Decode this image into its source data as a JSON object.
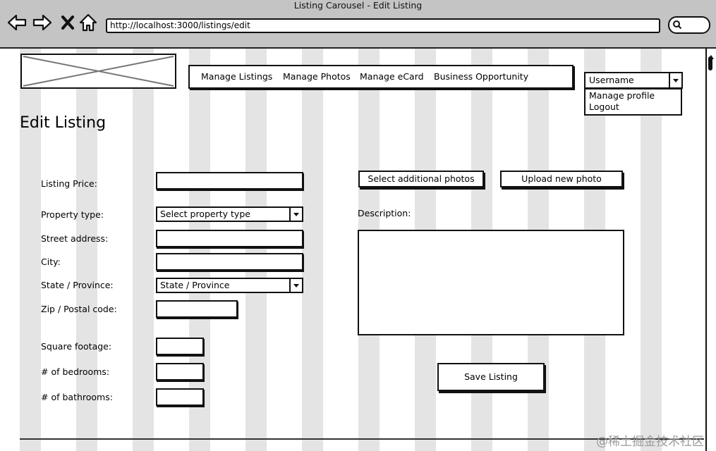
{
  "browser": {
    "window_title": "Listing Carousel - Edit Listing",
    "url": "http://localhost:3000/listings/edit",
    "nav_icons": [
      "back-arrow-icon",
      "forward-arrow-icon",
      "stop-icon",
      "home-icon"
    ],
    "search_icon": "search-icon"
  },
  "header": {
    "logo_icon": "image-placeholder-icon",
    "nav": [
      "Manage Listings",
      "Manage Photos",
      "Manage eCard",
      "Business Opportunity"
    ],
    "user": {
      "selected": "Username",
      "menu": [
        "Manage profile",
        "Logout"
      ]
    }
  },
  "main": {
    "title": "Edit Listing",
    "form": {
      "listing_price": {
        "label": "Listing Price:",
        "value": ""
      },
      "property_type": {
        "label": "Property type:",
        "value": "Select property type"
      },
      "street_address": {
        "label": "Street address:",
        "value": ""
      },
      "city": {
        "label": "City:",
        "value": ""
      },
      "state": {
        "label": "State / Province:",
        "value": "State / Province"
      },
      "zip": {
        "label": "Zip / Postal code:",
        "value": ""
      },
      "square_footage": {
        "label": "Square footage:",
        "value": ""
      },
      "bedrooms": {
        "label": "# of bedrooms:",
        "value": ""
      },
      "bathrooms": {
        "label": "# of bathrooms:",
        "value": ""
      }
    },
    "photos": {
      "select_label": "Select additional photos",
      "upload_label": "Upload new photo"
    },
    "description": {
      "label": "Description:",
      "value": ""
    },
    "save_label": "Save Listing"
  },
  "watermark": "@稀土掘金技术社区",
  "colors": {
    "chrome": "#c4c4c4",
    "grid_column": "#e4e4e4",
    "ink": "#111111"
  }
}
